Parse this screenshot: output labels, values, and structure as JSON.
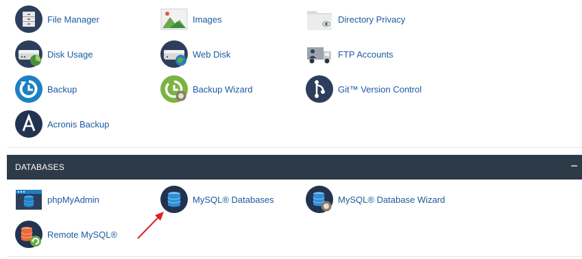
{
  "files": {
    "items": [
      {
        "label": "File Manager",
        "icon": "file-manager-icon"
      },
      {
        "label": "Images",
        "icon": "images-icon"
      },
      {
        "label": "Directory Privacy",
        "icon": "directory-privacy-icon"
      },
      {
        "label": "Disk Usage",
        "icon": "disk-usage-icon"
      },
      {
        "label": "Web Disk",
        "icon": "web-disk-icon"
      },
      {
        "label": "FTP Accounts",
        "icon": "ftp-accounts-icon"
      },
      {
        "label": "Backup",
        "icon": "backup-icon"
      },
      {
        "label": "Backup Wizard",
        "icon": "backup-wizard-icon"
      },
      {
        "label": "Git™ Version Control",
        "icon": "git-icon"
      },
      {
        "label": "Acronis Backup",
        "icon": "acronis-icon"
      }
    ]
  },
  "databases": {
    "header": "DATABASES",
    "collapse_symbol": "−",
    "items": [
      {
        "label": "phpMyAdmin",
        "icon": "phpmyadmin-icon"
      },
      {
        "label": "MySQL® Databases",
        "icon": "mysql-databases-icon"
      },
      {
        "label": "MySQL® Database Wizard",
        "icon": "mysql-wizard-icon"
      },
      {
        "label": "Remote MySQL®",
        "icon": "remote-mysql-icon"
      }
    ]
  },
  "colors": {
    "link": "#1a5aa0",
    "header_bg": "#2d3a47",
    "icon_navy": "#2d3e5c",
    "icon_blue": "#1d80c3",
    "arrow": "#e02020"
  }
}
